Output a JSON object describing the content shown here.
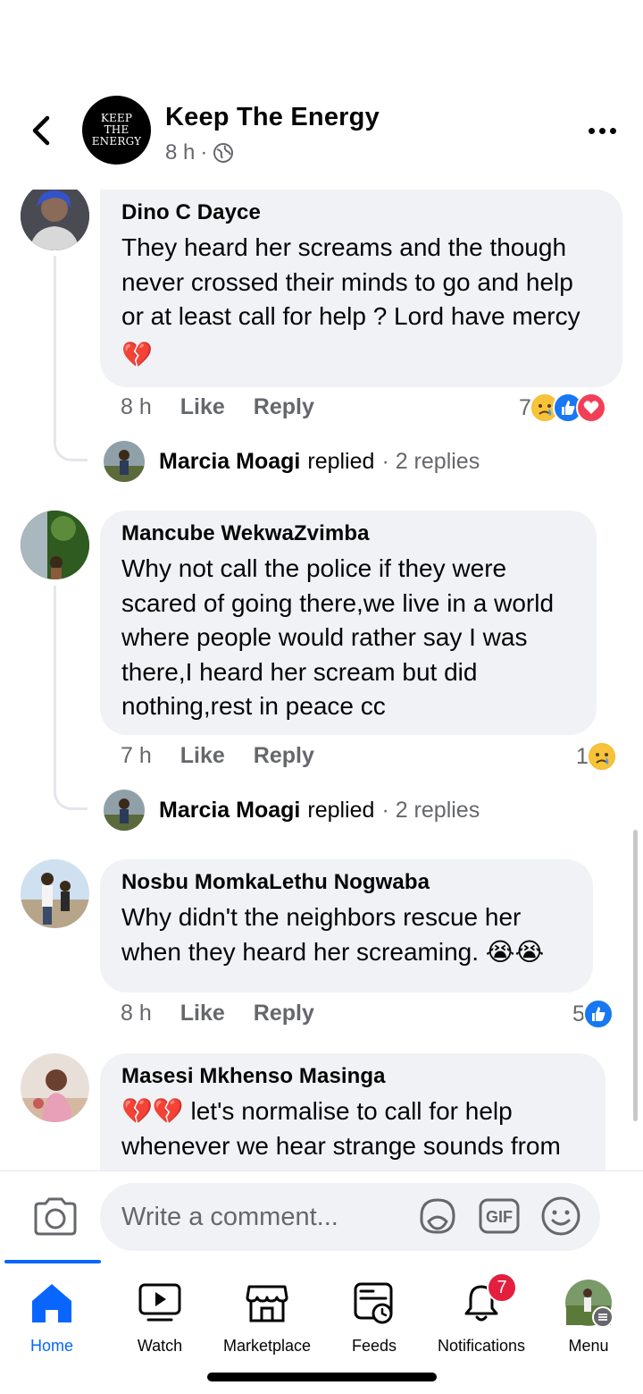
{
  "header": {
    "title": "Keep The Energy",
    "avatar_text": [
      "KEEP",
      "THE",
      "ENERGY"
    ],
    "time": "8 h",
    "separator": "·",
    "privacy_icon": "globe-icon"
  },
  "comments": [
    {
      "author": "Dino C Dayce",
      "text": "They heard her screams and the though never crossed their minds to go and help or at least call for help ? Lord have mercy",
      "emoji": "💔",
      "time": "8 h",
      "like": "Like",
      "reply": "Reply",
      "reaction_count": "7",
      "reactions": [
        "sad",
        "like",
        "love"
      ],
      "replied_by": "Marcia Moagi",
      "replied_word": "replied",
      "reply_count": "· 2 replies"
    },
    {
      "author": "Mancube WekwaZvimba",
      "text": "Why not call the police if they were scared of going there,we live in a world where people would rather say I was there,I heard her scream but did nothing,rest in peace cc",
      "time": "7 h",
      "like": "Like",
      "reply": "Reply",
      "reaction_count": "1",
      "reactions": [
        "sad"
      ],
      "replied_by": "Marcia Moagi",
      "replied_word": "replied",
      "reply_count": "· 2 replies"
    },
    {
      "author": "Nosbu MomkaLethu Nogwaba",
      "text": "Why didn't the neighbors rescue her when they heard her screaming.",
      "emoji": "😭😭",
      "time": "8 h",
      "like": "Like",
      "reply": "Reply",
      "reaction_count": "5",
      "reactions": [
        "like"
      ]
    },
    {
      "author": "Masesi Mkhenso Masinga",
      "emoji": "💔💔",
      "text": "let's normalise to call for help whenever we hear strange sounds from"
    }
  ],
  "composer": {
    "placeholder": "Write a comment...",
    "gif_label": "GIF"
  },
  "nav": {
    "home": "Home",
    "watch": "Watch",
    "marketplace": "Marketplace",
    "feeds": "Feeds",
    "notifications": "Notifications",
    "notifications_badge": "7",
    "menu": "Menu"
  },
  "colors": {
    "accent": "#0866ff",
    "bubble": "#f0f2f5",
    "secondary_text": "#65676b",
    "badge": "#e41e3f"
  }
}
